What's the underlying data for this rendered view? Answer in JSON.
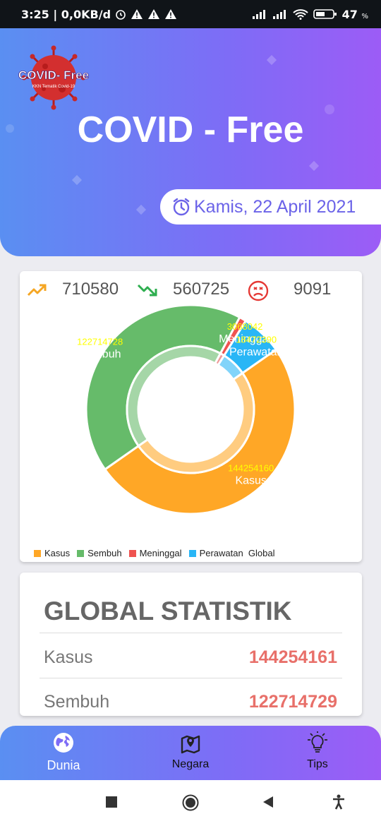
{
  "status_bar": {
    "left_text": "3:25 | 0,0KB/d",
    "battery": "47",
    "battery_unit": "%"
  },
  "header": {
    "logo_text": "COVID- Free",
    "logo_subtitle": "KKN Tematik Covid-19",
    "title": "COVID - Free",
    "date": "Kamis, 22 April 2021"
  },
  "summary": {
    "cases": "710580",
    "recovered": "560725",
    "deaths": "9091",
    "icons": [
      "trending-up-icon",
      "trending-down-icon",
      "sad-face-icon"
    ]
  },
  "chart_data": {
    "type": "pie",
    "donut": true,
    "categories": [
      "Kasus",
      "Sembuh",
      "Meninggal",
      "Perawatan Global"
    ],
    "values": [
      144254160,
      122714728,
      3068042,
      18472390
    ],
    "value_labels": [
      "144254160",
      "122714728",
      "3068042",
      "18472390"
    ],
    "slice_labels": [
      "Kasus",
      "Sembuh",
      "Meninggal",
      "Perawatan"
    ],
    "colors": [
      "#ffa726",
      "#66bb6a",
      "#ef5350",
      "#29b6f6"
    ],
    "legend": [
      "Kasus",
      "Sembuh",
      "Meninggal",
      "Perawatan  Global"
    ],
    "legend_position": "bottom-left"
  },
  "global_stats": {
    "title": "GLOBAL STATISTIK",
    "rows": [
      {
        "label": "Kasus",
        "value": "144254161"
      },
      {
        "label": "Sembuh",
        "value": "122714729"
      }
    ]
  },
  "bottom_nav": {
    "items": [
      {
        "label": "Dunia",
        "icon": "globe-icon",
        "active": true
      },
      {
        "label": "Negara",
        "icon": "map-pin-icon",
        "active": false
      },
      {
        "label": "Tips",
        "icon": "lightbulb-icon",
        "active": false
      }
    ]
  },
  "colors": {
    "accent_purple": "#7e6cf6",
    "accent_blue": "#5a8ff2",
    "value_red": "#e8706a"
  }
}
